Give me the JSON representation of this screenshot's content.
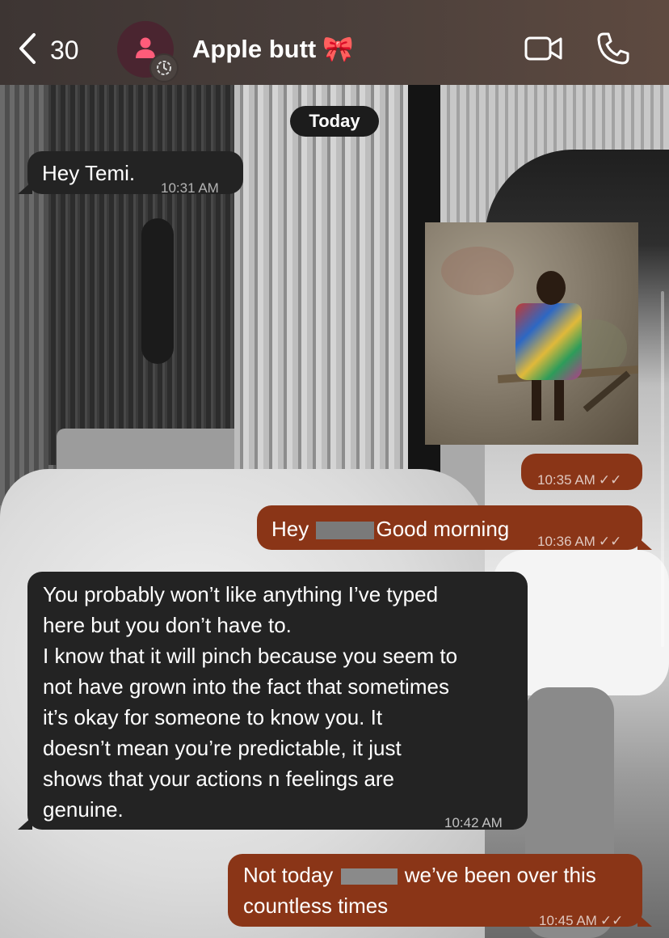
{
  "header": {
    "back_count": "30",
    "contact_name": "Apple butt",
    "contact_emoji": "🎀",
    "icons": {
      "back": "chevron-left-icon",
      "avatar": "person-icon",
      "avatar_status": "timer-icon",
      "video": "video-camera-icon",
      "call": "phone-icon"
    }
  },
  "date_chip": "Today",
  "messages": [
    {
      "direction": "incoming",
      "text": "Hey Temi.",
      "time": "10:31 AM"
    },
    {
      "direction": "outgoing",
      "type": "image",
      "time": "10:35 AM",
      "status": "read"
    },
    {
      "direction": "outgoing",
      "text_before": "Hey",
      "text_after": "Good morning",
      "time": "10:36 AM",
      "status": "read"
    },
    {
      "direction": "incoming",
      "lines": [
        "You probably won’t like anything I’ve typed",
        "here but you don’t have to.",
        "I know that it will pinch because you seem to",
        "not have grown into the fact that sometimes",
        "it’s okay for someone to know you. It",
        "doesn’t mean you’re predictable, it just",
        "shows that your actions n feelings are",
        "genuine."
      ],
      "time": "10:42 AM"
    },
    {
      "direction": "outgoing",
      "line1_before": "Not today",
      "line1_after": "we’ve been over this",
      "line2": "countless times",
      "time": "10:45 AM",
      "status": "read"
    }
  ],
  "read_ticks": "✓✓",
  "colors": {
    "incoming_bubble": "#232323",
    "outgoing_bubble": "#8a3517",
    "header_bg": "#3d3533",
    "avatar_bg": "#4a2530",
    "avatar_icon": "#ff5c7a"
  }
}
